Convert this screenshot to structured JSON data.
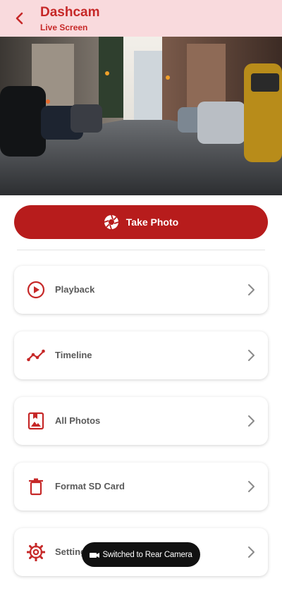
{
  "header": {
    "title": "Dashcam",
    "subtitle": "Live Screen"
  },
  "actions": {
    "take_photo_label": "Take Photo"
  },
  "menu": {
    "items": [
      {
        "label": "Playback",
        "icon": "play-circle-icon"
      },
      {
        "label": "Timeline",
        "icon": "timeline-icon"
      },
      {
        "label": "All Photos",
        "icon": "photo-album-icon"
      },
      {
        "label": "Format SD Card",
        "icon": "trash-icon"
      },
      {
        "label": "Settings",
        "icon": "gear-icon"
      }
    ]
  },
  "toast": {
    "message": "Switched to Rear Camera",
    "icon": "camera-icon"
  },
  "colors": {
    "accent": "#b71c1c",
    "header_bg": "#f9dadd",
    "title": "#c62828"
  }
}
